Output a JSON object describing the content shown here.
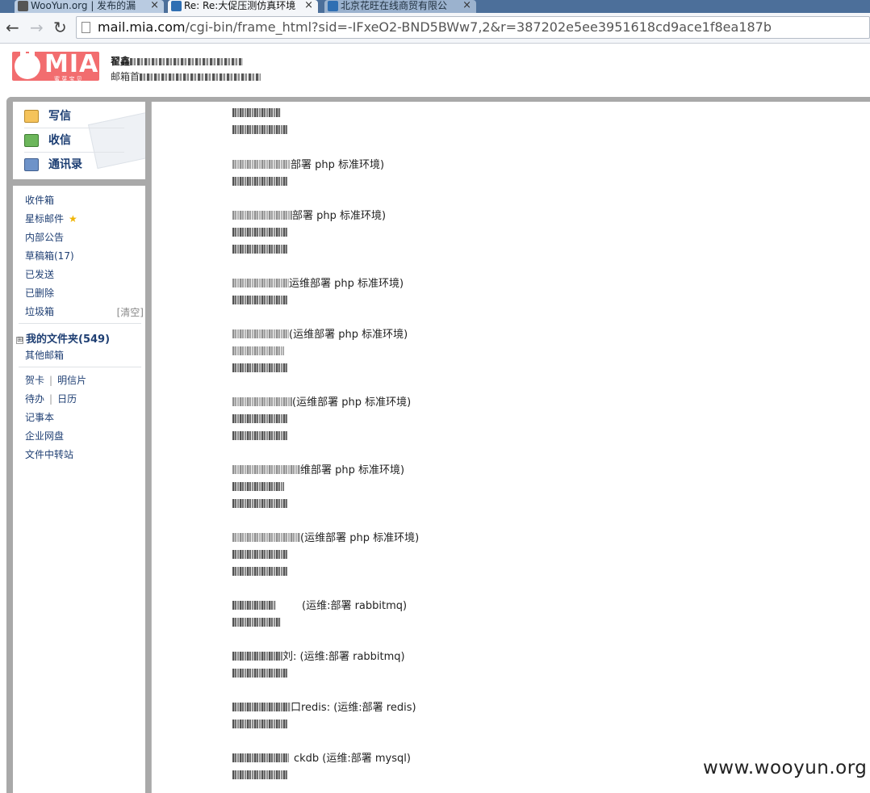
{
  "browser": {
    "tabs": [
      {
        "title": "WooYun.org | 发布的漏",
        "close": "×"
      },
      {
        "title": "Re: Re:大促压测仿真环境",
        "close": "×"
      },
      {
        "title": "北京花旺在线商贸有限公",
        "close": "×"
      }
    ],
    "nav": {
      "back": "←",
      "forward": "→",
      "reload": "↻"
    },
    "url_host": "mail.mia.com",
    "url_path": "/cgi-bin/frame_html?sid=-IFxeO2-BND5BWw7,2&r=387202e5ee3951618cd9ace1f8ea187b"
  },
  "header": {
    "logo_text": "MIA",
    "logo_sub": "蜜 芽 宝 贝",
    "user_name_prefix": "翟鑫",
    "user_email_prefix": "邮箱首"
  },
  "actions": [
    {
      "label": "写信",
      "icon": "compose-icon"
    },
    {
      "label": "收信",
      "icon": "inbox-download-icon"
    },
    {
      "label": "通讯录",
      "icon": "contacts-icon"
    }
  ],
  "folders": {
    "inbox": "收件箱",
    "starred": "星标邮件",
    "starred_icon": "★",
    "notice": "内部公告",
    "drafts": "草稿箱(17)",
    "sent": "已发送",
    "deleted": "已删除",
    "spam": "垃圾箱",
    "spam_clear": "[清空]",
    "my_folders_toggle": "⊞",
    "my_folders": "我的文件夹(549)",
    "other_mailbox": "其他邮箱",
    "greeting_card": "贺卡",
    "postcard": "明信片",
    "todo": "待办",
    "calendar": "日历",
    "notepad": "记事本",
    "netdisk": "企业网盘",
    "transfer": "文件中转站",
    "separator": "|"
  },
  "entries": [
    {
      "note": ""
    },
    {
      "note": "部署 php 标准环境)"
    },
    {
      "note": "部署 php 标准环境)"
    },
    {
      "note": "运维部署 php 标准环境)"
    },
    {
      "note": "(运维部署 php 标准环境)"
    },
    {
      "note": "(运维部署 php 标准环境)"
    },
    {
      "note": "维部署 php 标准环境)"
    },
    {
      "note": "(运维部署 php 标准环境)"
    },
    {
      "note": "(运维:部署 rabbitmq)"
    },
    {
      "note": "刘:  (运维:部署 rabbitmq)"
    },
    {
      "note": "口redis: (运维:部署 redis)"
    },
    {
      "note": "ckdb (运维:部署 mysql)"
    }
  ],
  "watermark": "www.wooyun.org",
  "colors": {
    "tab_bar": "#4c6f9a",
    "frame_border": "#a9a9a9",
    "link": "#1f3f73",
    "logo": "#f26d6f"
  }
}
